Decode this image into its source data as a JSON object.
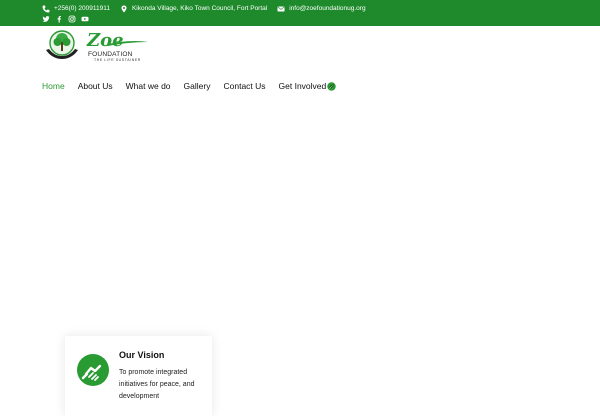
{
  "topbar": {
    "phone": "+256(0) 200911911",
    "address": "Kikonda Village, Kiko Town Council, Fort Portal",
    "email": "info@zoefoundationug.org",
    "icons": [
      "phone-icon",
      "map-marker-icon",
      "envelope-icon"
    ],
    "social_icons": [
      "twitter-icon",
      "facebook-icon",
      "instagram-icon",
      "youtube-icon"
    ],
    "background": "#1e8a2b"
  },
  "logo": {
    "name": "Zoe",
    "word": "FOUNDATION",
    "tagline": "THE LIFE SUSTAINER"
  },
  "nav": {
    "items": [
      "Home",
      "About Us",
      "What we do",
      "Gallery",
      "Contact Us",
      "Get Involved"
    ],
    "active": "Home",
    "active_color": "#2a9a33"
  },
  "vision": {
    "title": "Our Vision",
    "text": "To promote integrated initiatives for peace, and development",
    "icon": "handshake-icon",
    "icon_color": "#2a9a33"
  }
}
